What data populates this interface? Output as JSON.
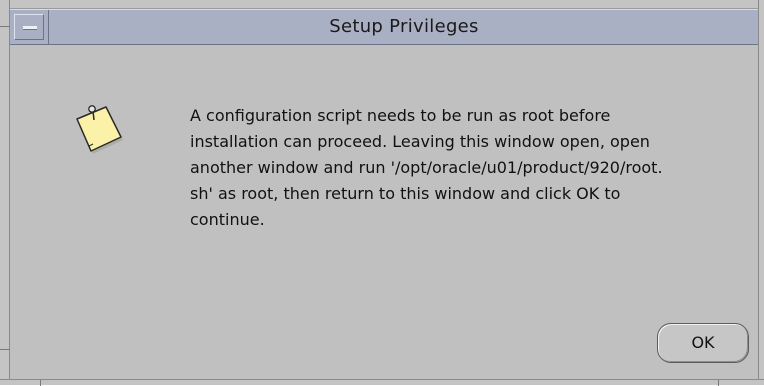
{
  "dialog": {
    "title": "Setup Privileges",
    "message": "A configuration script needs to be run as root before\ninstallation can proceed. Leaving this window open, open\nanother window and run '/opt/oracle/u01/product/920/root.\nsh' as root, then return to this window and click OK to\ncontinue.",
    "ok_label": "OK"
  },
  "icons": {
    "window_menu": "window-menu-icon",
    "message": "note-icon"
  },
  "colors": {
    "window_background": "#c0c0c0",
    "titlebar": "#aab0c4",
    "note_paper": "#fbf1a8"
  }
}
